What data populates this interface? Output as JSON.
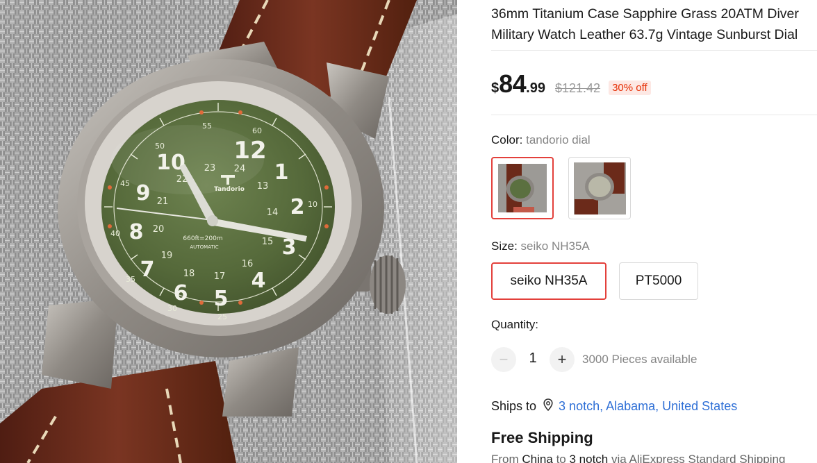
{
  "product": {
    "title": "36mm Titanium Case Sapphire Grass 20ATM Diver\nMilitary Watch Leather 63.7g Vintage Sunburst Dial",
    "main_image_icon": "watch-photo",
    "dial_brand": "Tandorio",
    "dial_text": "660ft=200m",
    "dial_subtext": "AUTOMATIC"
  },
  "price": {
    "currency": "$",
    "integer": "84",
    "decimal": ".99",
    "original": "$121.42",
    "discount": "30% off"
  },
  "color": {
    "label": "Color:",
    "value": "tandorio dial",
    "options": [
      {
        "name": "tandorio dial",
        "selected": true
      },
      {
        "name": "white dial",
        "selected": false
      }
    ]
  },
  "size": {
    "label": "Size:",
    "value": "seiko NH35A",
    "options": [
      {
        "label": "seiko NH35A",
        "selected": true
      },
      {
        "label": "PT5000",
        "selected": false
      }
    ]
  },
  "quantity": {
    "label": "Quantity:",
    "minus": "−",
    "plus": "+",
    "value": "1",
    "available": "3000 Pieces available"
  },
  "shipping": {
    "ships_to_label": "Ships to",
    "location": "3 notch, Alabama, United States",
    "free_label": "Free Shipping",
    "from_prefix": "From",
    "from_country": "China",
    "to_word": "to",
    "to_place": "3 notch",
    "via_text": "via AliExpress Standard Shipping"
  },
  "colors": {
    "accent_red": "#e3403b",
    "price_red": "#e62e04",
    "link_blue": "#2e6fd6",
    "dial_green": "#5b7040",
    "strap_brown": "#6b2a1a"
  }
}
